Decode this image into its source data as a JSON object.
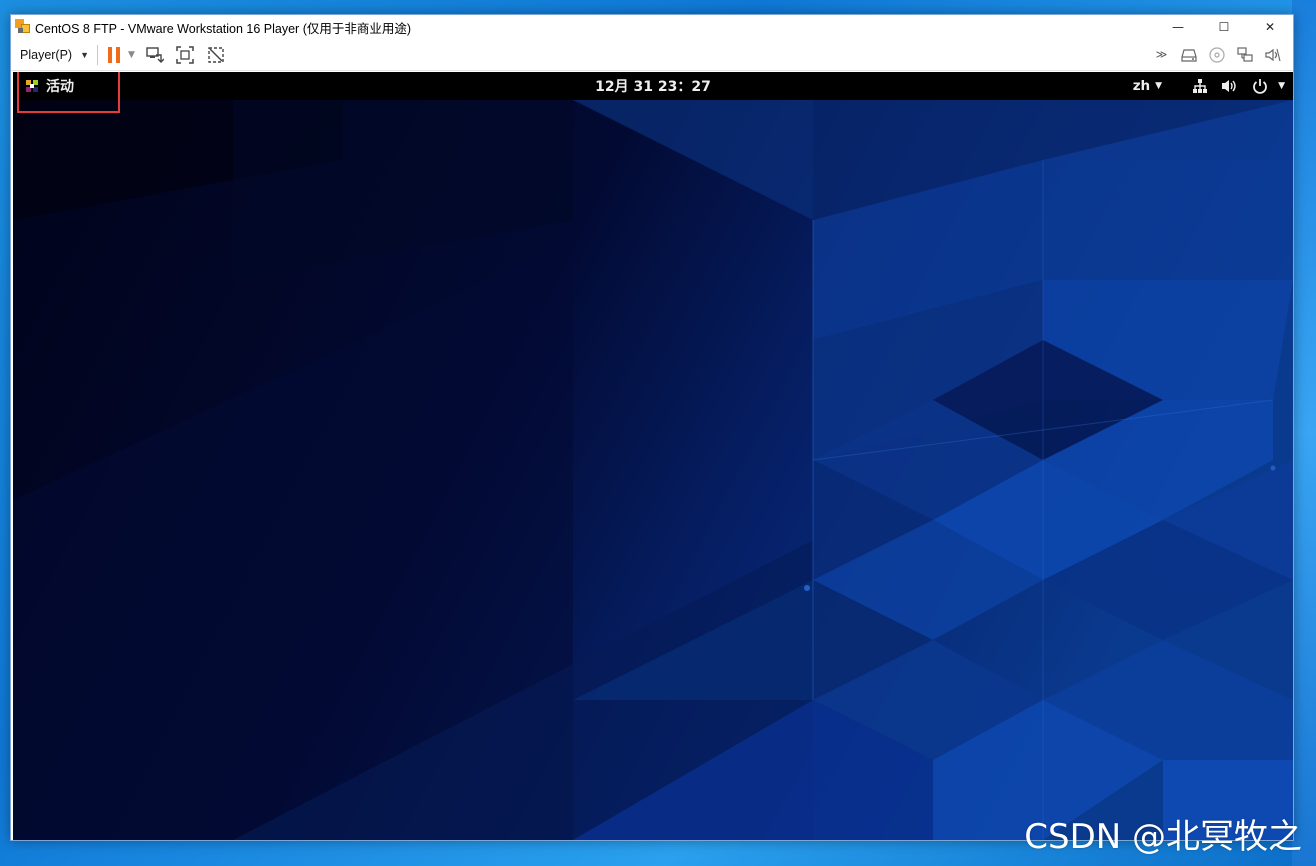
{
  "window": {
    "title": "CentOS 8 FTP - VMware Workstation 16 Player (仅用于非商业用途)",
    "minimize_glyph": "—",
    "maximize_glyph": "☐",
    "close_glyph": "✕"
  },
  "toolbar": {
    "player_menu_label": "Player(P)",
    "player_menu_caret": "▼",
    "pause_caret": "▼",
    "icons": [
      "pause-icon",
      "send-ctrl-alt-del-icon",
      "fullscreen-icon",
      "unity-icon"
    ],
    "right_icons": [
      "more-icon",
      "hard-disk-icon",
      "cd-icon",
      "network-adapter-icon",
      "sound-icon"
    ],
    "more_label": "≫",
    "accent_color": "#ef6c1a"
  },
  "gnome": {
    "activities_label": "活动",
    "clock": "12月 31  23：27",
    "language": "zh",
    "dropdown_glyph": "▼",
    "tray_icons": [
      "network-icon",
      "volume-icon",
      "power-icon"
    ]
  },
  "watermark": "CSDN @北冥牧之",
  "colors": {
    "topbar": "#000000",
    "highlight": "#e63b3b",
    "wallpaper_dark": "#02072a",
    "wallpaper_blue": "#0b3f9a"
  }
}
